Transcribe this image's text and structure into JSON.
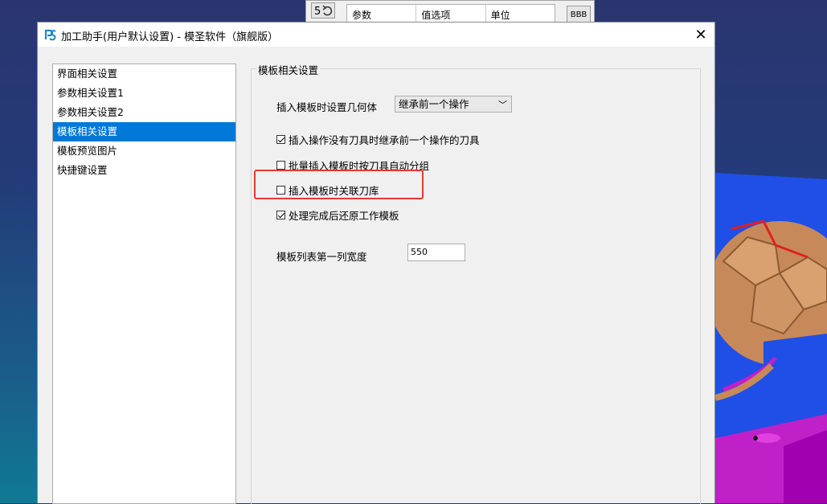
{
  "background_window": {
    "grid_headers": [
      "参数",
      "值选项",
      "单位"
    ],
    "button_label": "BBB"
  },
  "dialog": {
    "title": "加工助手(用户默认设置) - 模圣软件（旗舰版）",
    "close_glyph": "✕"
  },
  "nav": {
    "items": [
      {
        "label": "界面相关设置",
        "selected": false
      },
      {
        "label": "参数相关设置1",
        "selected": false
      },
      {
        "label": "参数相关设置2",
        "selected": false
      },
      {
        "label": "模板相关设置",
        "selected": true
      },
      {
        "label": "模板预览图片",
        "selected": false
      },
      {
        "label": "快捷键设置",
        "selected": false
      }
    ]
  },
  "group": {
    "title": "模板相关设置",
    "geometry_label": "插入模板时设置几何体",
    "geometry_value": "继承前一个操作",
    "options": [
      {
        "label": "插入操作没有刀具时继承前一个操作的刀具",
        "checked": true
      },
      {
        "label": "批量插入模板时按刀具自动分组",
        "checked": false
      },
      {
        "label": "插入模板时关联刀库",
        "checked": false
      },
      {
        "label": "处理完成后还原工作模板",
        "checked": true
      }
    ],
    "width_label": "模板列表第一列宽度",
    "width_value": "550"
  },
  "colors": {
    "selection": "#0078d7",
    "highlight": "#e53935"
  }
}
